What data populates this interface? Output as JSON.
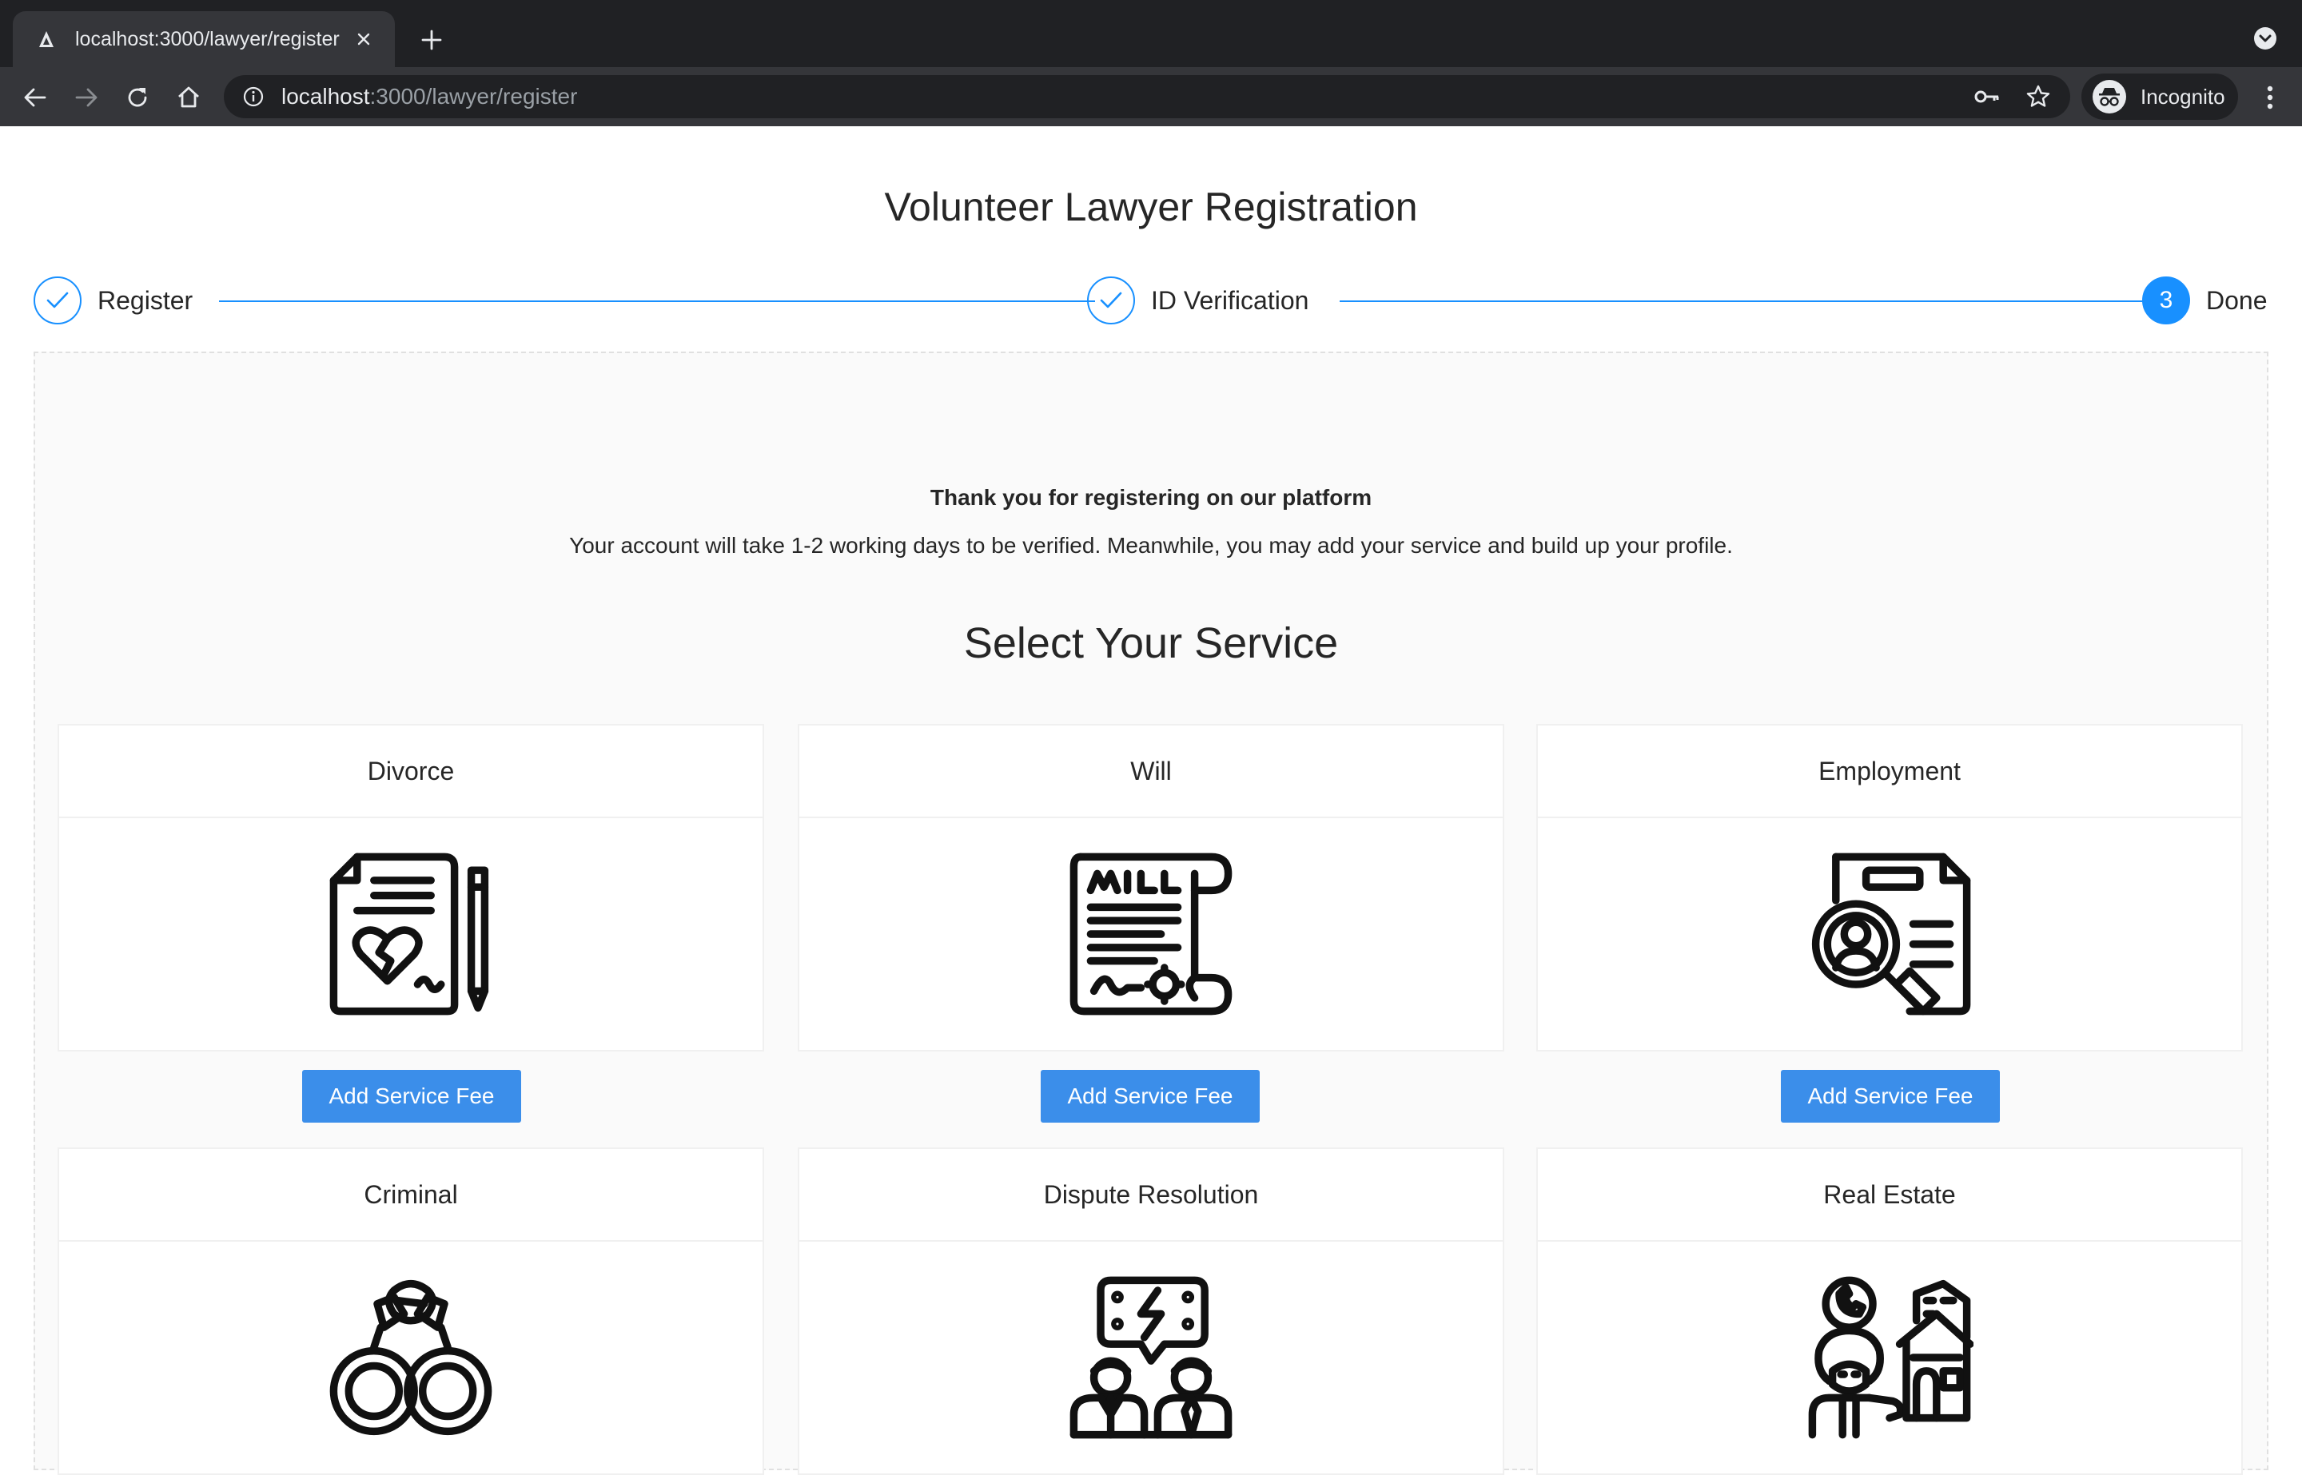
{
  "browser": {
    "tab_title": "localhost:3000/lawyer/register",
    "url_host": "localhost",
    "url_path": ":3000/lawyer/register",
    "profile_label": "Incognito"
  },
  "page": {
    "title": "Volunteer Lawyer Registration",
    "steps": [
      {
        "label": "Register",
        "status": "finished"
      },
      {
        "label": "ID Verification",
        "status": "finished"
      },
      {
        "label": "Done",
        "status": "active",
        "number": "3"
      }
    ],
    "thanks_title": "Thank you for registering on our platform",
    "thanks_text": "Your account will take 1-2 working days to be verified. Meanwhile, you may add your service and build up your profile.",
    "section_title": "Select Your Service",
    "button_label": "Add Service Fee",
    "services": [
      {
        "name": "Divorce",
        "icon": "divorce-document-icon"
      },
      {
        "name": "Will",
        "icon": "will-scroll-icon"
      },
      {
        "name": "Employment",
        "icon": "employee-search-icon"
      },
      {
        "name": "Criminal",
        "icon": "handcuffs-icon"
      },
      {
        "name": "Dispute Resolution",
        "icon": "dispute-people-icon"
      },
      {
        "name": "Real Estate",
        "icon": "real-estate-agent-icon"
      }
    ]
  },
  "colors": {
    "primary": "#1890ff",
    "button": "#3b8eea",
    "chrome_dark": "#202124",
    "chrome_toolbar": "#35363a"
  }
}
